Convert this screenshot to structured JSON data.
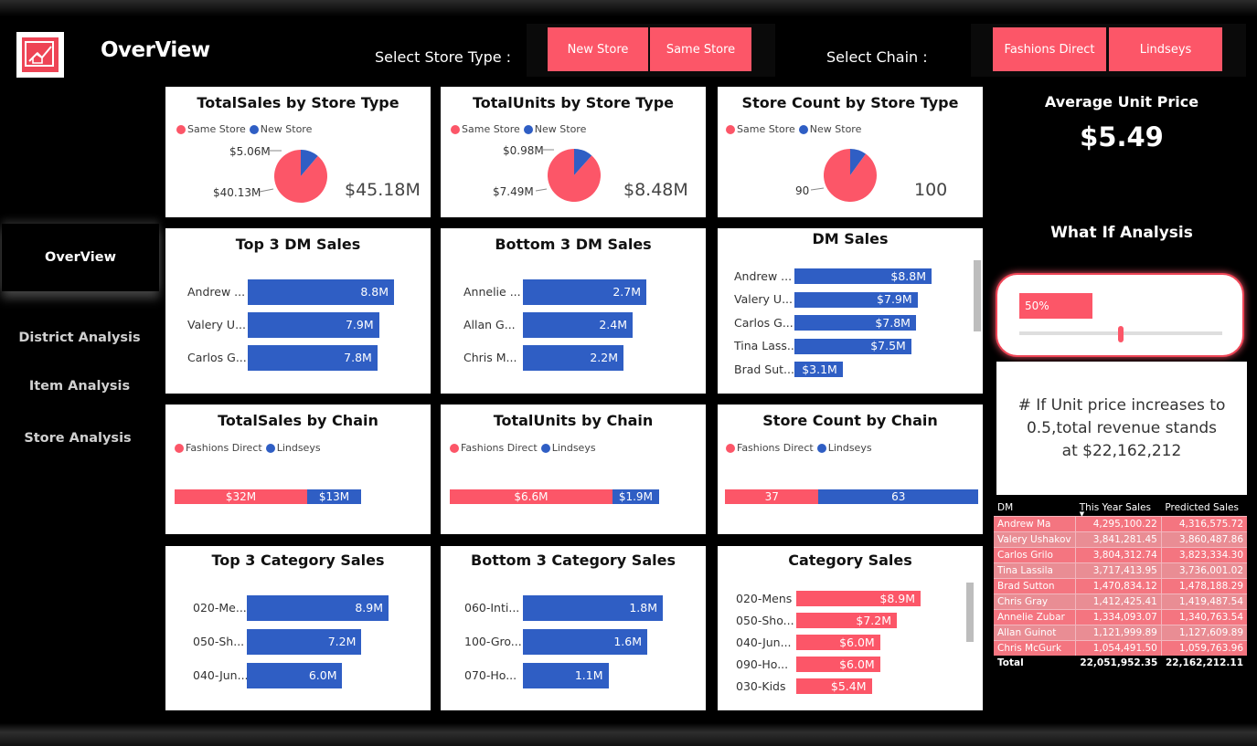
{
  "app": {
    "title": "OverView"
  },
  "slicers": {
    "store_type": {
      "label": "Select Store Type :",
      "options": [
        "New Store",
        "Same Store"
      ]
    },
    "chain": {
      "label": "Select Chain :",
      "options": [
        "Fashions Direct",
        "Lindseys"
      ]
    }
  },
  "nav": {
    "items": [
      "OverView",
      "District Analysis",
      "Item Analysis",
      "Store Analysis"
    ],
    "active": "OverView"
  },
  "colors": {
    "pink": "#fc5668",
    "blue": "#2f5ec4",
    "accent": "#ee4455"
  },
  "cards": {
    "sales_type": {
      "title": "TotalSales by Store Type",
      "legend": [
        "Same Store",
        "New Store"
      ],
      "labels": [
        "$5.06M",
        "$40.13M"
      ],
      "total": "$45.18M"
    },
    "units_type": {
      "title": "TotalUnits by Store Type",
      "legend": [
        "Same Store",
        "New Store"
      ],
      "labels": [
        "$0.98M",
        "$7.49M"
      ],
      "total": "$8.48M"
    },
    "count_type": {
      "title": "Store Count by Store Type",
      "legend": [
        "Same Store",
        "New Store"
      ],
      "labels": [
        "90"
      ],
      "total": "100"
    },
    "top_dm": {
      "title": "Top 3 DM Sales"
    },
    "bottom_dm": {
      "title": "Bottom 3 DM Sales"
    },
    "dm_sales": {
      "title": "DM Sales"
    },
    "sales_chain": {
      "title": "TotalSales by Chain",
      "legend": [
        "Fashions Direct",
        "Lindseys"
      ]
    },
    "units_chain": {
      "title": "TotalUnits by Chain",
      "legend": [
        "Fashions Direct",
        "Lindseys"
      ]
    },
    "count_chain": {
      "title": "Store Count by Chain",
      "legend": [
        "Fashions Direct",
        "Lindseys"
      ]
    },
    "top_cat": {
      "title": "Top 3 Category Sales"
    },
    "bottom_cat": {
      "title": "Bottom  3 Category Sales"
    },
    "cat_sales": {
      "title": "Category Sales"
    }
  },
  "kpi": {
    "title": "Average Unit Price",
    "value": "$5.49"
  },
  "whatif": {
    "title": "What If Analysis",
    "value": "50%",
    "level": 0.5,
    "note": "# If Unit price increases to 0.5,total revenue stands at $22,162,212"
  },
  "chart_data": [
    {
      "id": "sales_type",
      "type": "pie",
      "labels": [
        "New Store",
        "Same Store"
      ],
      "values": [
        5.06,
        40.13
      ],
      "display": [
        "$5.06M",
        "$40.13M"
      ]
    },
    {
      "id": "units_type",
      "type": "pie",
      "labels": [
        "New Store",
        "Same Store"
      ],
      "values": [
        0.98,
        7.49
      ],
      "display": [
        "$0.98M",
        "$7.49M"
      ]
    },
    {
      "id": "count_type",
      "type": "pie",
      "labels": [
        "New Store",
        "Same Store"
      ],
      "values": [
        10,
        90
      ]
    },
    {
      "id": "top_dm",
      "type": "bar",
      "categories": [
        "Andrew ...",
        "Valery U...",
        "Carlos G..."
      ],
      "values": [
        8.8,
        7.9,
        7.8
      ],
      "display": [
        "8.8M",
        "7.9M",
        "7.8M"
      ]
    },
    {
      "id": "bottom_dm",
      "type": "bar",
      "categories": [
        "Annelie ...",
        "Allan G...",
        "Chris M..."
      ],
      "values": [
        2.7,
        2.4,
        2.2
      ],
      "display": [
        "2.7M",
        "2.4M",
        "2.2M"
      ]
    },
    {
      "id": "dm_sales",
      "type": "bar",
      "categories": [
        "Andrew ...",
        "Valery U...",
        "Carlos G...",
        "Tina Lass...",
        "Brad Sut..."
      ],
      "values": [
        8.8,
        7.9,
        7.8,
        7.5,
        3.1
      ],
      "display": [
        "$8.8M",
        "$7.9M",
        "$7.8M",
        "$7.5M",
        "$3.1M"
      ]
    },
    {
      "id": "sales_chain",
      "type": "bar",
      "stacked": true,
      "series": [
        {
          "name": "Fashions Direct",
          "values": [
            32
          ],
          "display": "$32M"
        },
        {
          "name": "Lindseys",
          "values": [
            13
          ],
          "display": "$13M"
        }
      ]
    },
    {
      "id": "units_chain",
      "type": "bar",
      "stacked": true,
      "series": [
        {
          "name": "Fashions Direct",
          "values": [
            6.6
          ],
          "display": "$6.6M"
        },
        {
          "name": "Lindseys",
          "values": [
            1.9
          ],
          "display": "$1.9M"
        }
      ]
    },
    {
      "id": "count_chain",
      "type": "bar",
      "stacked": true,
      "series": [
        {
          "name": "Fashions Direct",
          "values": [
            37
          ],
          "display": "37"
        },
        {
          "name": "Lindseys",
          "values": [
            63
          ],
          "display": "63"
        }
      ]
    },
    {
      "id": "top_cat",
      "type": "bar",
      "categories": [
        "020-Me...",
        "050-Sh...",
        "040-Jun..."
      ],
      "values": [
        8.9,
        7.2,
        6.0
      ],
      "display": [
        "8.9M",
        "7.2M",
        "6.0M"
      ]
    },
    {
      "id": "bottom_cat",
      "type": "bar",
      "categories": [
        "060-Inti...",
        "100-Gro...",
        "070-Ho..."
      ],
      "values": [
        1.8,
        1.6,
        1.1
      ],
      "display": [
        "1.8M",
        "1.6M",
        "1.1M"
      ]
    },
    {
      "id": "cat_sales",
      "type": "bar",
      "categories": [
        "020-Mens",
        "050-Sho...",
        "040-Jun...",
        "090-Ho...",
        "030-Kids"
      ],
      "values": [
        8.9,
        7.2,
        6.0,
        6.0,
        5.4
      ],
      "display": [
        "$8.9M",
        "$7.2M",
        "$6.0M",
        "$6.0M",
        "$5.4M"
      ]
    }
  ],
  "table": {
    "headers": [
      "DM",
      "This Year Sales",
      "Predicted Sales"
    ],
    "rows": [
      [
        "Andrew Ma",
        "4,295,100.22",
        "4,316,575.72"
      ],
      [
        "Valery Ushakov",
        "3,841,281.45",
        "3,860,487.86"
      ],
      [
        "Carlos Grilo",
        "3,804,312.74",
        "3,823,334.30"
      ],
      [
        "Tina Lassila",
        "3,717,413.95",
        "3,736,001.02"
      ],
      [
        "Brad Sutton",
        "1,470,834.12",
        "1,478,188.29"
      ],
      [
        "Chris Gray",
        "1,412,425.41",
        "1,419,487.54"
      ],
      [
        "Annelie Zubar",
        "1,334,093.07",
        "1,340,763.54"
      ],
      [
        "Allan Guinot",
        "1,121,999.89",
        "1,127,609.89"
      ],
      [
        "Chris McGurk",
        "1,054,491.50",
        "1,059,763.96"
      ]
    ],
    "total": [
      "Total",
      "22,051,952.35",
      "22,162,212.11"
    ]
  }
}
